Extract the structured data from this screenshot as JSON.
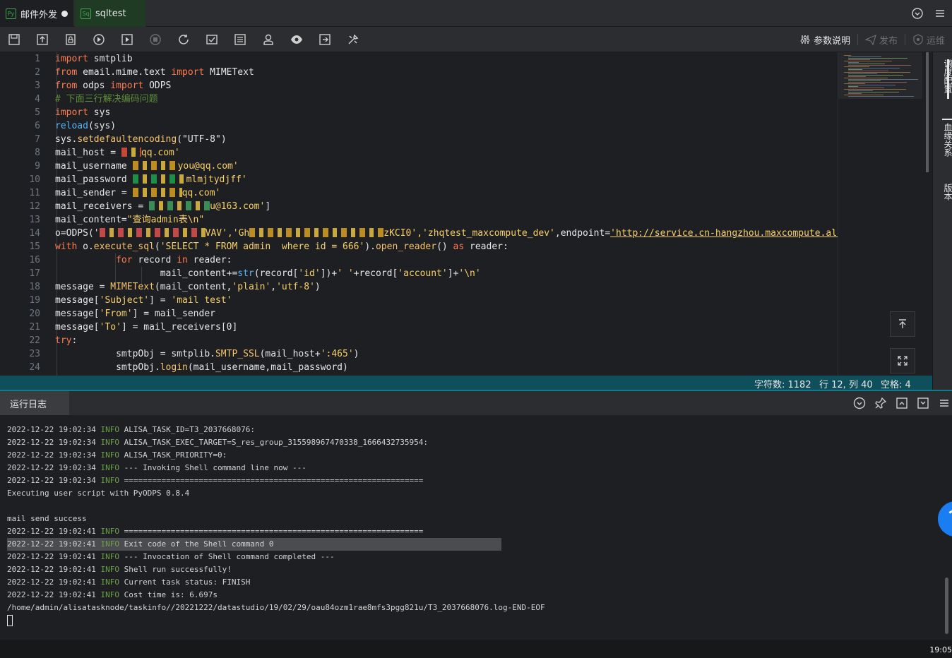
{
  "tabs": [
    {
      "label": "邮件外发",
      "lang": "Py",
      "modified": true,
      "active": true
    },
    {
      "label": "sqltest",
      "lang": "Sq",
      "modified": false,
      "active": false
    }
  ],
  "toolbar": {
    "params_label": "参数说明",
    "publish_label": "发布",
    "ops_label": "运维"
  },
  "rail": {
    "schedule_label": "调度配置",
    "lineage_label": "血缘关系",
    "version_label": "版本"
  },
  "code_lines": [
    {
      "n": "1",
      "segs": [
        [
          "kw",
          "import"
        ],
        [
          "",
          "smtplib"
        ]
      ],
      "sep": [
        " "
      ]
    },
    {
      "n": "2",
      "segs": [
        [
          "kw",
          "from"
        ],
        [
          "",
          " email.mime.text "
        ],
        [
          "kw",
          "import"
        ],
        [
          "",
          " MIMEText"
        ]
      ]
    },
    {
      "n": "3",
      "segs": [
        [
          "kw",
          "from"
        ],
        [
          "",
          " odps "
        ],
        [
          "kw",
          "import"
        ],
        [
          "",
          " ODPS"
        ]
      ]
    },
    {
      "n": "4",
      "segs": [
        [
          "cm",
          "# 下面三行解决编码问题"
        ]
      ]
    },
    {
      "n": "5",
      "segs": [
        [
          "kw",
          "import"
        ],
        [
          "",
          " sys"
        ]
      ]
    },
    {
      "n": "6",
      "segs": [
        [
          "bi",
          "reload"
        ],
        [
          "",
          "(sys)"
        ]
      ]
    },
    {
      "n": "7",
      "segs": [
        [
          "",
          "sys."
        ],
        [
          "fn",
          "setdefaultencoding"
        ],
        [
          "",
          "(\"UTF-8\")"
        ]
      ]
    },
    {
      "n": "8",
      "segs": [
        [
          "",
          "mail_host = "
        ],
        [
          "blur",
          "#e0503a:28"
        ],
        [
          "str",
          "qq.com'"
        ]
      ]
    },
    {
      "n": "9",
      "segs": [
        [
          "",
          "mail_username "
        ],
        [
          "blur",
          "#d8a020:64"
        ],
        [
          "str",
          "you@qq.com'"
        ]
      ]
    },
    {
      "n": "10",
      "segs": [
        [
          "",
          "mail_password "
        ],
        [
          "blur",
          "#20a050:76"
        ],
        [
          "str",
          "mlmjtydjff'"
        ]
      ]
    },
    {
      "n": "11",
      "segs": [
        [
          "",
          "mail_sender = "
        ],
        [
          "blur",
          "#d8a020:70"
        ],
        [
          "str",
          "qq.com'"
        ]
      ]
    },
    {
      "n": "12",
      "segs": [
        [
          "",
          "mail_receivers = "
        ],
        [
          "blur",
          "#40a060:86"
        ],
        [
          "str",
          "u@163.com'"
        ],
        [
          "",
          "]"
        ]
      ]
    },
    {
      "n": "13",
      "segs": [
        [
          "",
          "mail_content="
        ],
        [
          "str",
          "\"查询admin表\\n\""
        ]
      ]
    },
    {
      "n": "14",
      "segs": [
        [
          "",
          "o=ODPS('"
        ],
        [
          "blur",
          "#e05050:150"
        ],
        [
          "str",
          "VAV','Gh"
        ],
        [
          "blur",
          "#d8a020:190"
        ],
        [
          "str",
          "zKCI0','zhqtest_maxcompute_dev'"
        ],
        [
          "",
          ",endpoint="
        ],
        [
          "link",
          "'http://service.cn-hangzhou.maxcompute.aliy"
        ]
      ]
    },
    {
      "n": "15",
      "segs": [
        [
          "kw",
          "with"
        ],
        [
          "",
          " o."
        ],
        [
          "fn",
          "execute_sql"
        ],
        [
          "",
          "("
        ],
        [
          "str",
          "'SELECT * FROM admin  where id = 666'"
        ],
        [
          "",
          ")."
        ],
        [
          "fn",
          "open_reader"
        ],
        [
          "",
          "() "
        ],
        [
          "kw",
          "as"
        ],
        [
          "",
          " reader:"
        ]
      ]
    },
    {
      "n": "16",
      "segs": [
        [
          "",
          "           "
        ],
        [
          "kw",
          "for"
        ],
        [
          "",
          " record "
        ],
        [
          "kw",
          "in"
        ],
        [
          "",
          " reader:"
        ]
      ]
    },
    {
      "n": "17",
      "segs": [
        [
          "",
          "                   mail_content+="
        ],
        [
          "bi",
          "str"
        ],
        [
          "",
          "(record["
        ],
        [
          "str",
          "'id'"
        ],
        [
          "",
          "])+"
        ],
        [
          "str",
          "' '"
        ],
        [
          "",
          "+record["
        ],
        [
          "str",
          "'account'"
        ],
        [
          "",
          "]+"
        ],
        [
          "str",
          "'\\n'"
        ]
      ]
    },
    {
      "n": "18",
      "segs": [
        [
          "",
          "message = "
        ],
        [
          "fn",
          "MIMEText"
        ],
        [
          "",
          "(mail_content,"
        ],
        [
          "str",
          "'plain'"
        ],
        [
          "",
          ","
        ],
        [
          "str",
          "'utf-8'"
        ],
        [
          "",
          ")"
        ]
      ]
    },
    {
      "n": "19",
      "segs": [
        [
          "",
          "message["
        ],
        [
          "str",
          "'Subject'"
        ],
        [
          "",
          "] = "
        ],
        [
          "str",
          "'mail test'"
        ]
      ]
    },
    {
      "n": "20",
      "segs": [
        [
          "",
          "message["
        ],
        [
          "str",
          "'From'"
        ],
        [
          "",
          "] = mail_sender"
        ]
      ]
    },
    {
      "n": "21",
      "segs": [
        [
          "",
          "message["
        ],
        [
          "str",
          "'To'"
        ],
        [
          "",
          "] = mail_receivers[0]"
        ]
      ]
    },
    {
      "n": "22",
      "segs": [
        [
          "kw",
          "try"
        ],
        [
          "",
          ":"
        ]
      ]
    },
    {
      "n": "23",
      "segs": [
        [
          "",
          "           smtpObj = smtplib."
        ],
        [
          "fn",
          "SMTP_SSL"
        ],
        [
          "",
          "(mail_host+"
        ],
        [
          "str",
          "':465'"
        ],
        [
          "",
          ")"
        ]
      ]
    },
    {
      "n": "24",
      "segs": [
        [
          "",
          "           smtpObj."
        ],
        [
          "fn",
          "login"
        ],
        [
          "",
          "(mail_username,mail_password)"
        ]
      ]
    }
  ],
  "status": {
    "chars": "字符数: 1182",
    "position": "行 12, 列 40",
    "indent": "空格: 4"
  },
  "log": {
    "tab_label": "运行日志",
    "lines": [
      {
        "ts": "2022-12-22 19:02:34",
        "lvl": "INFO",
        "msg": "ALISA_TASK_ID=T3_2037668076:"
      },
      {
        "ts": "2022-12-22 19:02:34",
        "lvl": "INFO",
        "msg": "ALISA_TASK_EXEC_TARGET=S_res_group_315598967470338_1666432735954:"
      },
      {
        "ts": "2022-12-22 19:02:34",
        "lvl": "INFO",
        "msg": "ALISA_TASK_PRIORITY=0:"
      },
      {
        "ts": "2022-12-22 19:02:34",
        "lvl": "INFO",
        "msg": "--- Invoking Shell command line now ---"
      },
      {
        "ts": "2022-12-22 19:02:34",
        "lvl": "INFO",
        "msg": "================================================================"
      },
      {
        "ts": "",
        "lvl": "",
        "msg": "Executing user script with PyODPS 0.8.4"
      },
      {
        "ts": "",
        "lvl": "",
        "msg": ""
      },
      {
        "ts": "",
        "lvl": "",
        "msg": "mail send success"
      },
      {
        "ts": "2022-12-22 19:02:41",
        "lvl": "INFO",
        "msg": "================================================================"
      },
      {
        "ts": "2022-12-22 19:02:41",
        "lvl": "INFO",
        "msg": "Exit code of the Shell command 0",
        "hl": true
      },
      {
        "ts": "2022-12-22 19:02:41",
        "lvl": "INFO",
        "msg": "--- Invocation of Shell command completed ---"
      },
      {
        "ts": "2022-12-22 19:02:41",
        "lvl": "INFO",
        "msg": "Shell run successfully!"
      },
      {
        "ts": "2022-12-22 19:02:41",
        "lvl": "INFO",
        "msg": "Current task status: FINISH"
      },
      {
        "ts": "2022-12-22 19:02:41",
        "lvl": "INFO",
        "msg": "Cost time is: 6.697s"
      },
      {
        "ts": "",
        "lvl": "",
        "msg": "/home/admin/alisatasknode/taskinfo//20221222/datastudio/19/02/29/oau84ozm1rae8mfs3pgg821u/T3_2037668076.log-END-EOF"
      }
    ]
  },
  "taskbar": {
    "clock": "19:05"
  },
  "colors": {
    "accent": "#117a8b",
    "status_bg": "#0f4f5b",
    "keyword": "#ff7b4f",
    "string": "#f7d068",
    "info": "#6aa14a"
  }
}
